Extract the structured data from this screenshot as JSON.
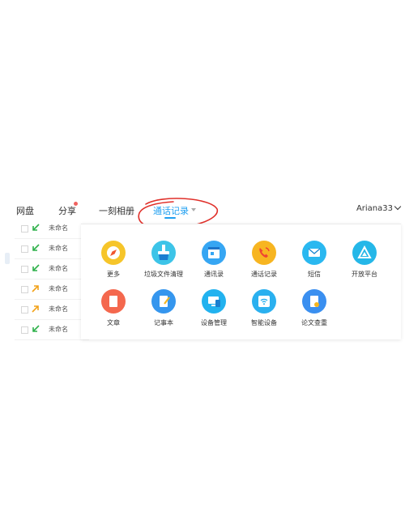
{
  "nav": {
    "items": [
      {
        "label": "网盘"
      },
      {
        "label": "分享"
      },
      {
        "label": "一刻相册"
      },
      {
        "label": "通话记录"
      }
    ],
    "user": "Ariana33"
  },
  "files": [
    {
      "name": "未命名",
      "direction": "incoming"
    },
    {
      "name": "未命名",
      "direction": "incoming"
    },
    {
      "name": "未命名",
      "direction": "incoming"
    },
    {
      "name": "未命名",
      "direction": "outgoing"
    },
    {
      "name": "未命名",
      "direction": "outgoing"
    },
    {
      "name": "未命名",
      "direction": "incoming"
    }
  ],
  "apps": [
    {
      "label": "更多",
      "icon": "compass-icon",
      "color": "#f6c52a"
    },
    {
      "label": "垃圾文件清理",
      "icon": "cleaner-icon",
      "color": "#3dc4e8"
    },
    {
      "label": "通讯录",
      "icon": "contacts-icon",
      "color": "#36a6f3"
    },
    {
      "label": "通话记录",
      "icon": "phone-icon",
      "color": "#f7b521"
    },
    {
      "label": "短信",
      "icon": "message-icon",
      "color": "#2ab8f0"
    },
    {
      "label": "开放平台",
      "icon": "platform-icon",
      "color": "#25b7e8"
    },
    {
      "label": "文章",
      "icon": "article-icon",
      "color": "#f4684e"
    },
    {
      "label": "记事本",
      "icon": "notepad-icon",
      "color": "#3596ee"
    },
    {
      "label": "设备管理",
      "icon": "device-icon",
      "color": "#22b2ef"
    },
    {
      "label": "智能设备",
      "icon": "wifi-icon",
      "color": "#2ab0ef"
    },
    {
      "label": "论文查重",
      "icon": "paper-check-icon",
      "color": "#3a8ff0"
    }
  ],
  "colors": {
    "accent": "#1f9ff0",
    "badge": "#f0625f",
    "annotation": "#e0302a",
    "incoming_arrow": "#2fb14b",
    "outgoing_arrow": "#f2a219"
  }
}
